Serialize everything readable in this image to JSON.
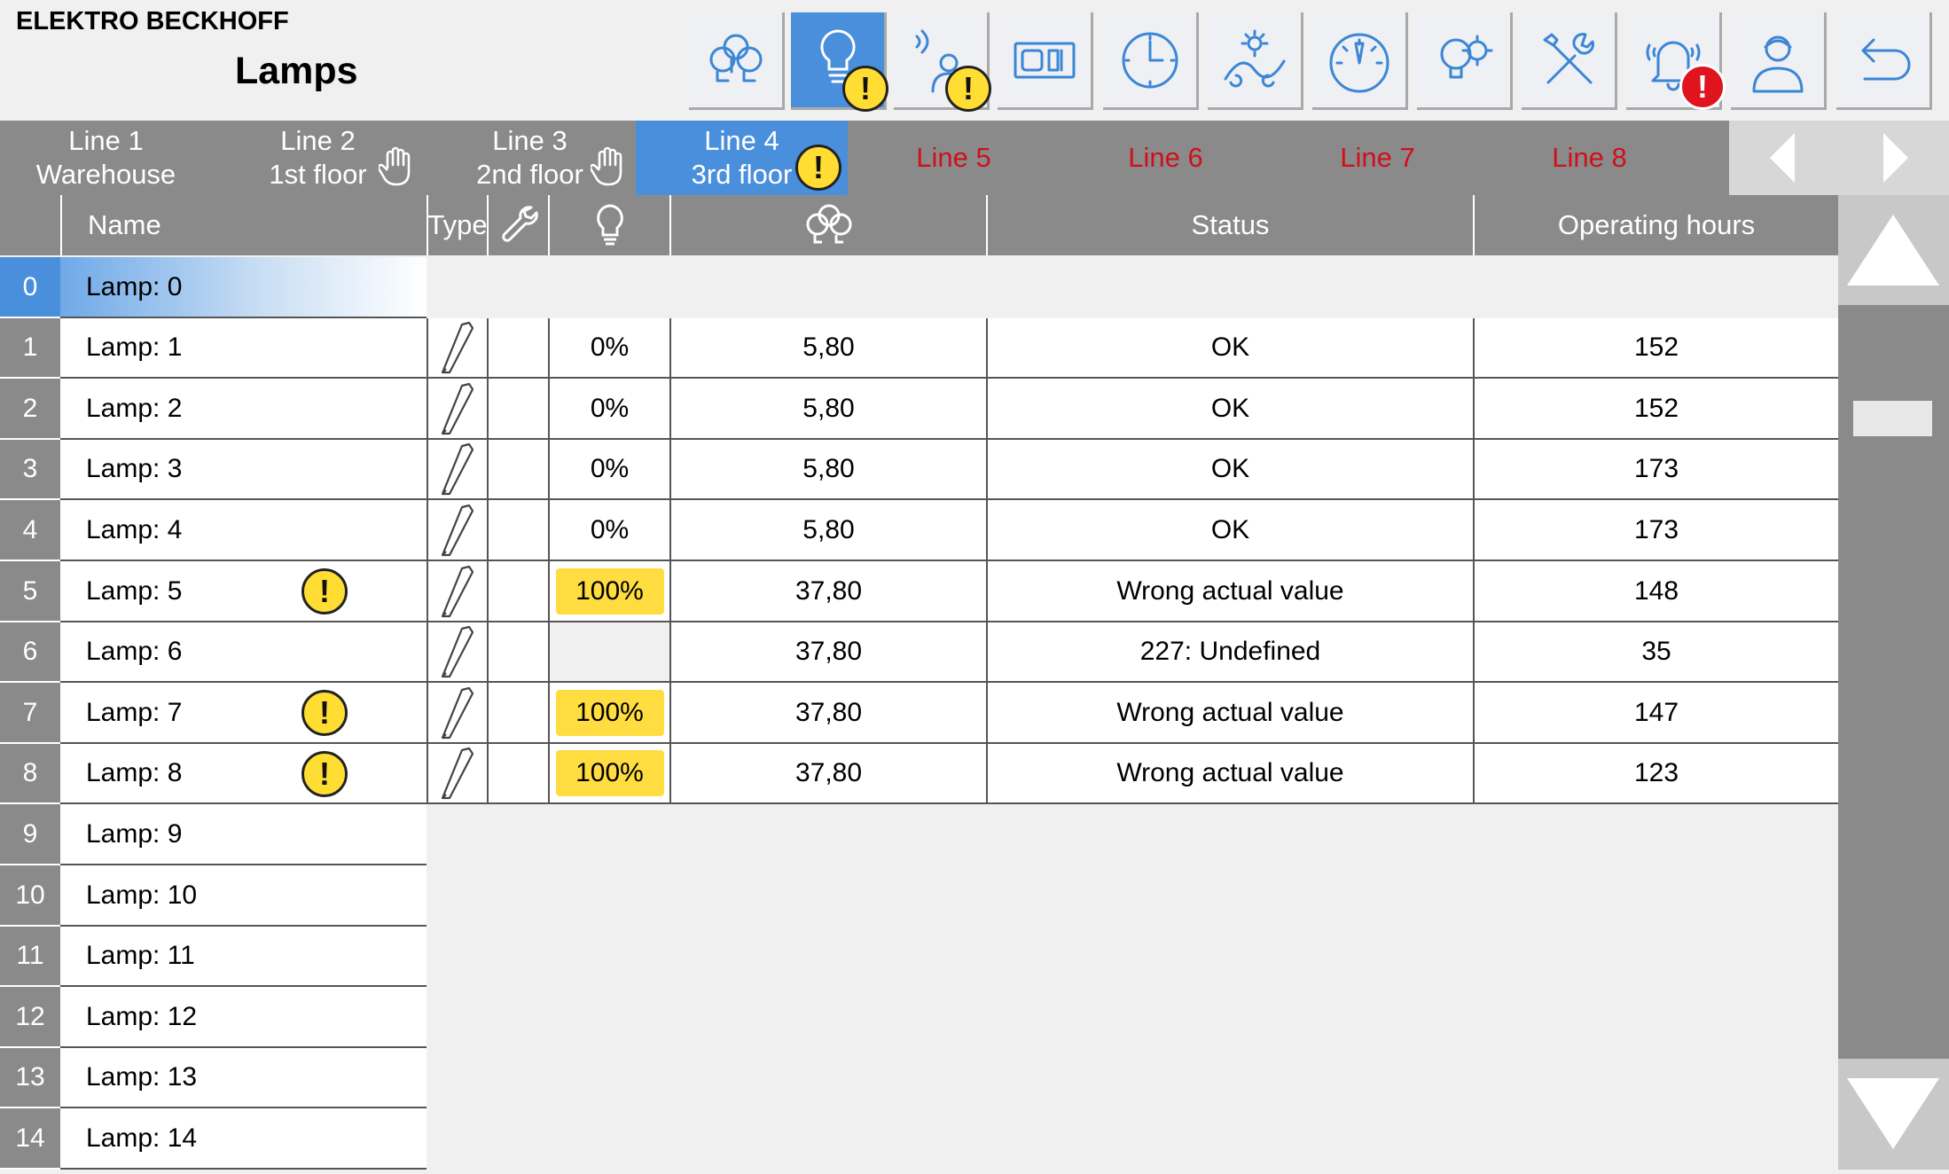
{
  "header": {
    "brand": "ELEKTRO BECKHOFF",
    "title": "Lamps"
  },
  "nav": {
    "icons": [
      "lamp-group-icon",
      "lamp-icon",
      "presence-sensor-icon",
      "switch-panel-icon",
      "clock-icon",
      "daylight-icon",
      "speedometer-icon",
      "lamp-settings-icon",
      "tools-icon",
      "alarm-bell-icon",
      "user-icon",
      "back-icon"
    ],
    "active_index": 1
  },
  "tabs": [
    {
      "line": "Line 1",
      "floor": "Warehouse",
      "state": "normal",
      "hand": false,
      "warn": false
    },
    {
      "line": "Line 2",
      "floor": "1st floor",
      "state": "normal",
      "hand": true,
      "warn": false
    },
    {
      "line": "Line 3",
      "floor": "2nd floor",
      "state": "normal",
      "hand": true,
      "warn": false
    },
    {
      "line": "Line 4",
      "floor": "3rd floor",
      "state": "active",
      "hand": false,
      "warn": true
    },
    {
      "line": "Line 5",
      "floor": "",
      "state": "off",
      "hand": false,
      "warn": false
    },
    {
      "line": "Line 6",
      "floor": "",
      "state": "off",
      "hand": false,
      "warn": false
    },
    {
      "line": "Line 7",
      "floor": "",
      "state": "off",
      "hand": false,
      "warn": false
    },
    {
      "line": "Line 8",
      "floor": "",
      "state": "off",
      "hand": false,
      "warn": false
    }
  ],
  "table": {
    "headers": {
      "name": "Name",
      "type": "Type",
      "status": "Status",
      "hours": "Operating hours"
    },
    "rows": [
      {
        "idx": "0",
        "name": "Lamp: 0",
        "warn": false,
        "detail": false,
        "selected": true
      },
      {
        "idx": "1",
        "name": "Lamp: 1",
        "warn": false,
        "detail": true,
        "dim": "0%",
        "dim_warn": false,
        "power": "5,80",
        "status": "OK",
        "hours": "152"
      },
      {
        "idx": "2",
        "name": "Lamp: 2",
        "warn": false,
        "detail": true,
        "dim": "0%",
        "dim_warn": false,
        "power": "5,80",
        "status": "OK",
        "hours": "152"
      },
      {
        "idx": "3",
        "name": "Lamp: 3",
        "warn": false,
        "detail": true,
        "dim": "0%",
        "dim_warn": false,
        "power": "5,80",
        "status": "OK",
        "hours": "173"
      },
      {
        "idx": "4",
        "name": "Lamp: 4",
        "warn": false,
        "detail": true,
        "dim": "0%",
        "dim_warn": false,
        "power": "5,80",
        "status": "OK",
        "hours": "173"
      },
      {
        "idx": "5",
        "name": "Lamp: 5",
        "warn": true,
        "detail": true,
        "dim": "100%",
        "dim_warn": true,
        "power": "37,80",
        "status": "Wrong actual value",
        "hours": "148"
      },
      {
        "idx": "6",
        "name": "Lamp: 6",
        "warn": false,
        "detail": true,
        "dim": "",
        "dim_warn": false,
        "dim_empty": true,
        "power": "37,80",
        "status": "227: Undefined",
        "hours": "35"
      },
      {
        "idx": "7",
        "name": "Lamp: 7",
        "warn": true,
        "detail": true,
        "dim": "100%",
        "dim_warn": true,
        "power": "37,80",
        "status": "Wrong actual value",
        "hours": "147"
      },
      {
        "idx": "8",
        "name": "Lamp: 8",
        "warn": true,
        "detail": true,
        "dim": "100%",
        "dim_warn": true,
        "power": "37,80",
        "status": "Wrong actual value",
        "hours": "123"
      },
      {
        "idx": "9",
        "name": "Lamp: 9",
        "warn": false,
        "detail": false
      },
      {
        "idx": "10",
        "name": "Lamp: 10",
        "warn": false,
        "detail": false
      },
      {
        "idx": "11",
        "name": "Lamp: 11",
        "warn": false,
        "detail": false
      },
      {
        "idx": "12",
        "name": "Lamp: 12",
        "warn": false,
        "detail": false
      },
      {
        "idx": "13",
        "name": "Lamp: 13",
        "warn": false,
        "detail": false
      },
      {
        "idx": "14",
        "name": "Lamp: 14",
        "warn": false,
        "detail": false
      }
    ]
  },
  "colors": {
    "accent": "#4a8fdc",
    "warning": "#ffdd33",
    "error": "#e0141e",
    "tab_off": "#d0101a",
    "bar": "#8a8a8a"
  }
}
